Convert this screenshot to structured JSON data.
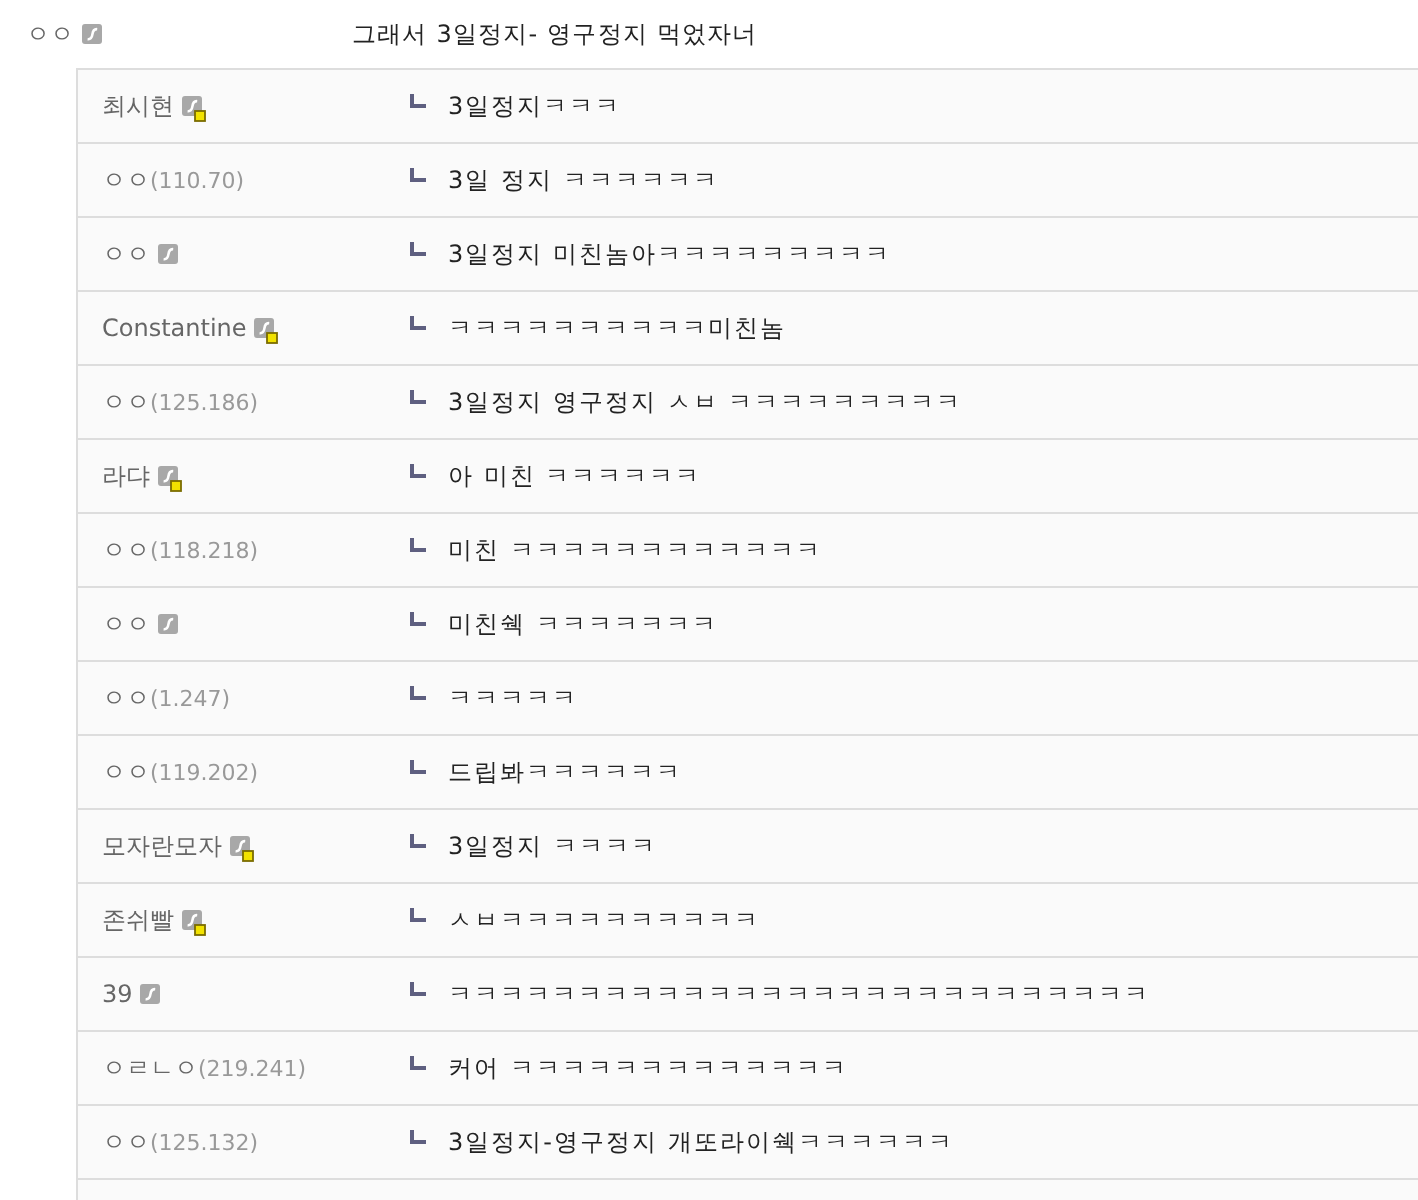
{
  "comment": {
    "kind": "member",
    "author": "ㅇㅇ",
    "text": "그래서 3일정지- 영구정지 먹었자너"
  },
  "replies": [
    {
      "kind": "fixed",
      "author": "최시현",
      "text": "3일정지ㅋㅋㅋ"
    },
    {
      "kind": "guest",
      "author": "ㅇㅇ",
      "ip": "(110.70)",
      "text": "3일 정지 ㅋㅋㅋㅋㅋㅋ"
    },
    {
      "kind": "member",
      "author": "ㅇㅇ",
      "text": "3일정지 미친놈아ㅋㅋㅋㅋㅋㅋㅋㅋㅋ"
    },
    {
      "kind": "fixed",
      "author": "Constantine",
      "text": "ㅋㅋㅋㅋㅋㅋㅋㅋㅋㅋ미친놈"
    },
    {
      "kind": "guest",
      "author": "ㅇㅇ",
      "ip": "(125.186)",
      "text": "3일정지 영구정지 ㅅㅂ ㅋㅋㅋㅋㅋㅋㅋㅋㅋ"
    },
    {
      "kind": "fixed",
      "author": "라댜",
      "text": "아 미친 ㅋㅋㅋㅋㅋㅋ"
    },
    {
      "kind": "guest",
      "author": "ㅇㅇ",
      "ip": "(118.218)",
      "text": "미친 ㅋㅋㅋㅋㅋㅋㅋㅋㅋㅋㅋㅋ"
    },
    {
      "kind": "member",
      "author": "ㅇㅇ",
      "text": "미친쉑 ㅋㅋㅋㅋㅋㅋㅋ"
    },
    {
      "kind": "guest",
      "author": "ㅇㅇ",
      "ip": "(1.247)",
      "text": "ㅋㅋㅋㅋㅋ"
    },
    {
      "kind": "guest",
      "author": "ㅇㅇ",
      "ip": "(119.202)",
      "text": "드립봐ㅋㅋㅋㅋㅋㅋ"
    },
    {
      "kind": "fixed",
      "author": "모자란모자",
      "text": "3일정지 ㅋㅋㅋㅋ"
    },
    {
      "kind": "fixed",
      "author": "존쉬빨",
      "text": "ㅅㅂㅋㅋㅋㅋㅋㅋㅋㅋㅋㅋ"
    },
    {
      "kind": "member",
      "author": "39",
      "text": "ㅋㅋㅋㅋㅋㅋㅋㅋㅋㅋㅋㅋㅋㅋㅋㅋㅋㅋㅋㅋㅋㅋㅋㅋㅋㅋㅋ"
    },
    {
      "kind": "guest",
      "author": "ㅇㄹㄴㅇ",
      "ip": "(219.241)",
      "text": "커어 ㅋㅋㅋㅋㅋㅋㅋㅋㅋㅋㅋㅋㅋ"
    },
    {
      "kind": "guest",
      "author": "ㅇㅇ",
      "ip": "(125.132)",
      "text": "3일정지-영구정지 개또라이쉑ㅋㅋㅋㅋㅋㅋ"
    }
  ]
}
